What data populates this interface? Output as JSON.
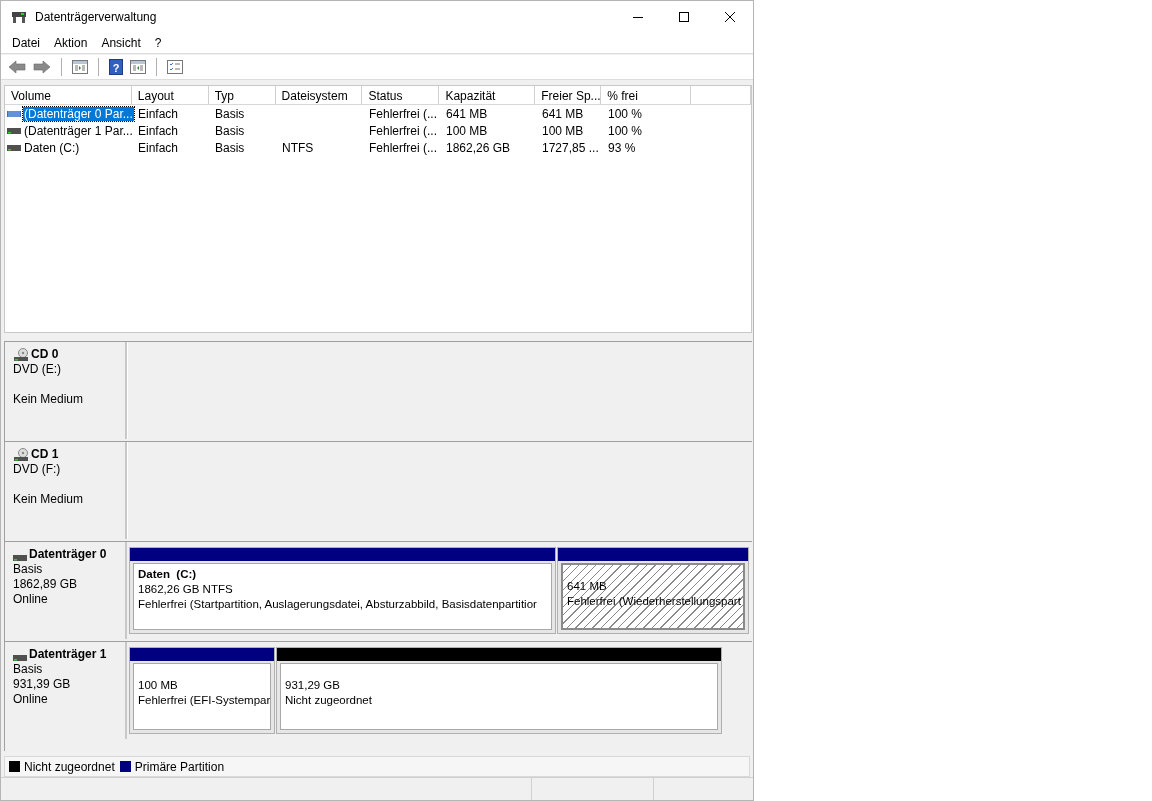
{
  "window": {
    "title": "Datenträgerverwaltung"
  },
  "menu": [
    "Datei",
    "Aktion",
    "Ansicht",
    "?"
  ],
  "toolbar": {
    "help_icon": "?"
  },
  "volumes": {
    "columns": [
      "Volume",
      "Layout",
      "Typ",
      "Dateisystem",
      "Status",
      "Kapazität",
      "Freier Sp...",
      "% frei"
    ],
    "rows": [
      {
        "selected": true,
        "cells": [
          "(Datenträger 0 Par...",
          "Einfach",
          "Basis",
          "",
          "Fehlerfrei (...",
          "641 MB",
          "641 MB",
          "100 %"
        ]
      },
      {
        "selected": false,
        "cells": [
          "(Datenträger 1 Par...",
          "Einfach",
          "Basis",
          "",
          "Fehlerfrei (...",
          "100 MB",
          "100 MB",
          "100 %"
        ]
      },
      {
        "selected": false,
        "cells": [
          "Daten (C:)",
          "Einfach",
          "Basis",
          "NTFS",
          "Fehlerfrei (...",
          "1862,26 GB",
          "1727,85 ...",
          "93 %"
        ]
      }
    ]
  },
  "disks": [
    {
      "kind": "cd",
      "name": "CD 0",
      "details": [
        "DVD (E:)"
      ],
      "status": "Kein Medium"
    },
    {
      "kind": "cd",
      "name": "CD 1",
      "details": [
        "DVD (F:)"
      ],
      "status": "Kein Medium"
    },
    {
      "kind": "disk",
      "name": "Datenträger 0",
      "details": [
        "Basis",
        "1862,89 GB",
        "Online"
      ],
      "partitions": [
        {
          "kind": "primary",
          "selected": false,
          "title": "Daten  (C:)",
          "lines": [
            "1862,26 GB NTFS",
            "Fehlerfrei (Startpartition, Auslagerungsdatei, Absturzabbild, Basisdatenpartitior"
          ]
        },
        {
          "kind": "primary",
          "selected": true,
          "lines": [
            "641 MB",
            "Fehlerfrei (Wiederherstellungspart"
          ]
        }
      ]
    },
    {
      "kind": "disk",
      "name": "Datenträger 1",
      "details": [
        "Basis",
        "931,39 GB",
        "Online"
      ],
      "partitions": [
        {
          "kind": "primary",
          "selected": false,
          "lines": [
            "100 MB",
            "Fehlerfrei (EFI-Systempar"
          ]
        },
        {
          "kind": "unallocated",
          "selected": false,
          "lines": [
            "931,29 GB",
            "Nicht zugeordnet"
          ]
        }
      ]
    }
  ],
  "legend": [
    {
      "label": "Nicht zugeordnet",
      "color": "#000000"
    },
    {
      "label": "Primäre Partition",
      "color": "#000080"
    }
  ]
}
